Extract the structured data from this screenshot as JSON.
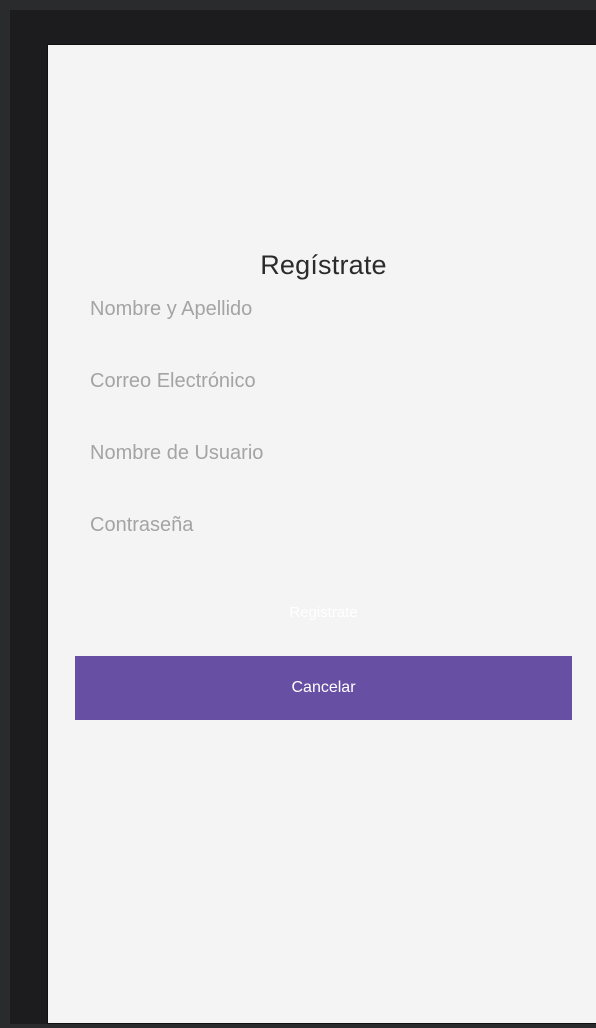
{
  "form": {
    "title": "Regístrate",
    "fields": [
      {
        "placeholder": "Nombre y Apellido",
        "value": ""
      },
      {
        "placeholder": "Correo Electrónico",
        "value": ""
      },
      {
        "placeholder": "Nombre de Usuario",
        "value": ""
      },
      {
        "placeholder": "Contraseña",
        "value": ""
      }
    ],
    "register_label": "Registrate",
    "cancel_label": "Cancelar"
  },
  "colors": {
    "accent": "#6750a4",
    "screen_background": "#f4f4f4",
    "frame": "#1c1c1e",
    "placeholder": "#a4a4a4"
  }
}
